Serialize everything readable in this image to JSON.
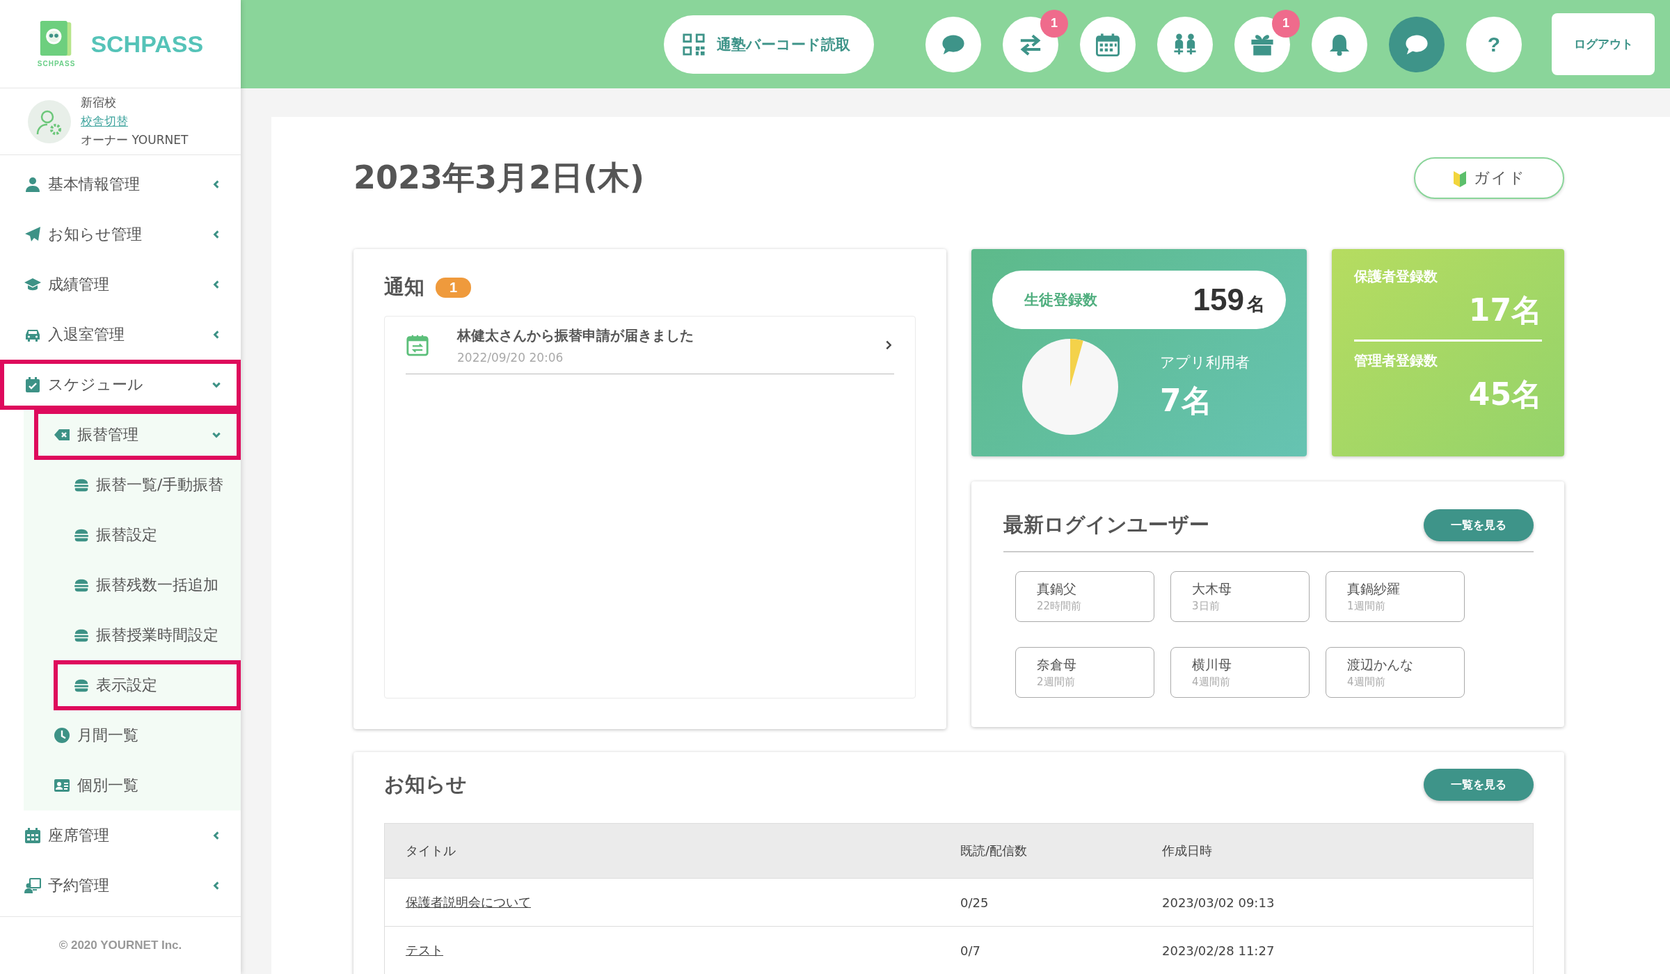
{
  "topbar": {
    "barcode_button": "通塾バーコード読取",
    "icon_buttons": [
      {
        "selected": false
      },
      {
        "badge": "1",
        "selected": false
      },
      {
        "selected": false
      },
      {
        "selected": false
      },
      {
        "badge": "1",
        "selected": false
      },
      {
        "selected": false
      },
      {
        "selected": true
      },
      {
        "label": "?",
        "selected": false
      }
    ],
    "logout_button": "ログアウト"
  },
  "sidebar": {
    "brand": "SCHPASS",
    "brand_small": "SCHPASS",
    "school": "新宿校",
    "switch_link": "校舎切替",
    "user": "オーナー YOURNET",
    "menu": [
      {
        "label": "基本情報管理",
        "expanded": false,
        "highlighted": false
      },
      {
        "label": "お知らせ管理",
        "expanded": false,
        "highlighted": false
      },
      {
        "label": "成績管理",
        "expanded": false,
        "highlighted": false
      },
      {
        "label": "入退室管理",
        "expanded": false,
        "highlighted": false
      },
      {
        "label": "スケジュール",
        "expanded": true,
        "highlighted": true,
        "children": [
          {
            "label": "振替管理",
            "expanded": true,
            "highlighted": true,
            "children": [
              {
                "label": "振替一覧/手動振替",
                "highlighted": false
              },
              {
                "label": "振替設定",
                "highlighted": false
              },
              {
                "label": "振替残数一括追加",
                "highlighted": false
              },
              {
                "label": "振替授業時間設定",
                "highlighted": false
              },
              {
                "label": "表示設定",
                "highlighted": true
              }
            ]
          },
          {
            "label": "月間一覧",
            "highlighted": false
          },
          {
            "label": "個別一覧",
            "highlighted": false
          }
        ]
      },
      {
        "label": "座席管理",
        "expanded": false,
        "highlighted": false
      },
      {
        "label": "予約管理",
        "expanded": false,
        "highlighted": false
      }
    ],
    "footer": "© 2020 YOURNET Inc."
  },
  "main": {
    "date_title": "2023年3月2日(木)",
    "guide_button": "ガイド",
    "notifications": {
      "title": "通知",
      "count": "1",
      "items": [
        {
          "message": "林健太さんから振替申請が届きました",
          "time": "2022/09/20 20:06"
        }
      ]
    },
    "student_stats": {
      "label": "生徒登録数",
      "value": "159",
      "unit": "名",
      "app_users_label": "アプリ利用者",
      "app_users_value": "7名"
    },
    "other_stats": [
      {
        "label": "保護者登録数",
        "value": "17名"
      },
      {
        "label": "管理者登録数",
        "value": "45名"
      }
    ],
    "recent_logins": {
      "title": "最新ログインユーザー",
      "button": "一覧を見る",
      "users": [
        {
          "name": "真鍋父",
          "time": "22時間前"
        },
        {
          "name": "大木母",
          "time": "3日前"
        },
        {
          "name": "真鍋紗羅",
          "time": "1週間前"
        },
        {
          "name": "奈倉母",
          "time": "2週間前"
        },
        {
          "name": "横川母",
          "time": "4週間前"
        },
        {
          "name": "渡辺かんな",
          "time": "4週間前"
        }
      ]
    },
    "news": {
      "title": "お知らせ",
      "button": "一覧を見る",
      "columns": [
        "タイトル",
        "既読/配信数",
        "作成日時"
      ],
      "rows": [
        [
          "保護者説明会について",
          "0/25",
          "2023/03/02 09:13"
        ],
        [
          "テスト",
          "0/7",
          "2023/02/28 11:27"
        ]
      ]
    }
  }
}
